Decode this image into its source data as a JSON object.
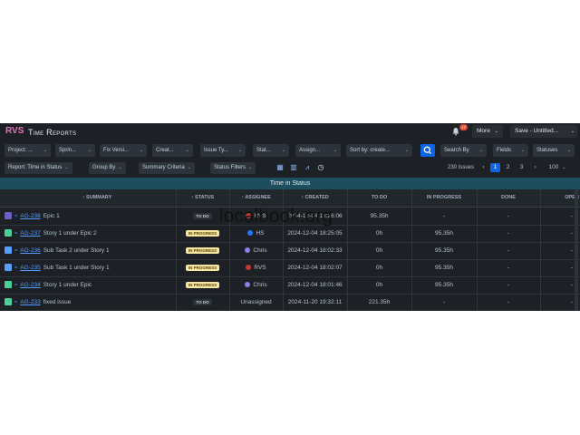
{
  "header": {
    "logo": "RVS",
    "title": "Time Reports",
    "notifications": "17",
    "more_label": "More",
    "save_label": "Save - Untitled..."
  },
  "filters_row1": [
    {
      "label": "Project: ..."
    },
    {
      "label": "Sprin..."
    },
    {
      "label": "Fix Versi..."
    },
    {
      "label": "Creat..."
    },
    {
      "label": "Issue Ty..."
    },
    {
      "label": "Stat..."
    },
    {
      "label": "Assign..."
    },
    {
      "label": "Sort by: create..."
    }
  ],
  "search_by_label": "Search By",
  "fields_label": "Fields",
  "statuses_label": "Statuses",
  "filters_row2": {
    "report": "Report: Time in Status",
    "group_by": "Group By",
    "summary_criteria": "Summary Criteria",
    "status_filters": "Status Filters"
  },
  "pagination": {
    "issues_count": "230 Issues",
    "pages": [
      "1",
      "2",
      "3"
    ],
    "per_page": "100"
  },
  "table": {
    "section_title": "Time in Status",
    "columns": {
      "summary": "↑ SUMMARY",
      "status": "↑ STATUS",
      "assignee": "↑ ASSIGNEE",
      "created": "↑ CREATED",
      "todo": "TO DO",
      "in_progress": "IN PROGRESS",
      "done": "DONE",
      "open": "OPEN"
    },
    "rows": [
      {
        "type_color": "#6e5dc6",
        "key": "AG-238",
        "summary": "Epic 1",
        "status": "TO DO",
        "assignee": "RVS",
        "created": "2024-12-04 18:26:06",
        "todo": "95.35h",
        "in_progress": "-",
        "done": "-",
        "open": "-"
      },
      {
        "type_color": "#4bce97",
        "key": "AG-237",
        "summary": "Story 1 under Epic 2",
        "status": "IN PROGRESS",
        "assignee": "HS",
        "created": "2024-12-04 18:25:05",
        "todo": "0h",
        "in_progress": "95.35h",
        "done": "-",
        "open": "-"
      },
      {
        "type_color": "#579dff",
        "key": "AG-236",
        "summary": "Sub Task 2 under Story 1",
        "status": "IN PROGRESS",
        "assignee": "Chris",
        "created": "2024-12-04 18:02:33",
        "todo": "0h",
        "in_progress": "95.35h",
        "done": "-",
        "open": "-"
      },
      {
        "type_color": "#579dff",
        "key": "AG-235",
        "summary": "Sub Task 1 under Story 1",
        "status": "IN PROGRESS",
        "assignee": "RVS",
        "created": "2024-12-04 18:02:07",
        "todo": "0h",
        "in_progress": "95.35h",
        "done": "-",
        "open": "-"
      },
      {
        "type_color": "#4bce97",
        "key": "AG-234",
        "summary": "Story 1 under Epic",
        "status": "IN PROGRESS",
        "assignee": "Chris",
        "created": "2024-12-04 18:01:46",
        "todo": "0h",
        "in_progress": "95.35h",
        "done": "-",
        "open": "-"
      },
      {
        "type_color": "#4bce97",
        "key": "AG-233",
        "summary": "fixed issue",
        "status": "TO DO",
        "assignee": "Unassigned",
        "created": "2024-11-20 19:32:11",
        "todo": "221.35h",
        "in_progress": "-",
        "done": "-",
        "open": "-"
      }
    ]
  },
  "watermark": "localbook.org"
}
